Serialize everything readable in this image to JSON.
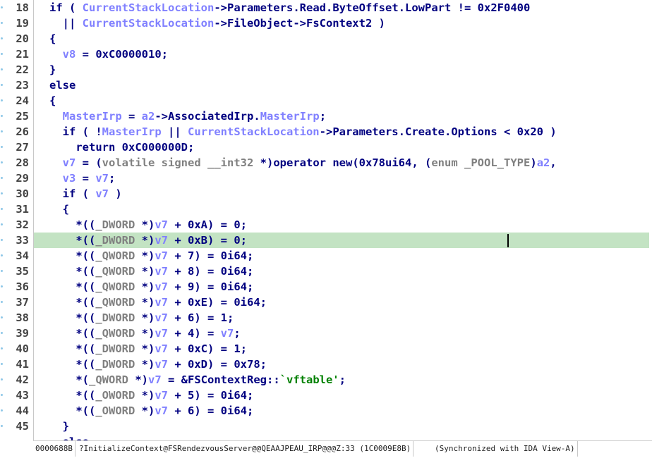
{
  "highlight_line": "33",
  "lines": [
    {
      "num": "18",
      "code": "if ( CurrentStackLocation->Parameters.Read.ByteOffset.LowPart != 0x2F0400"
    },
    {
      "num": "19",
      "code": "  || CurrentStackLocation->FileObject->FsContext2 )"
    },
    {
      "num": "20",
      "code": "{"
    },
    {
      "num": "21",
      "code": "  v8 = 0xC0000010;"
    },
    {
      "num": "22",
      "code": "}"
    },
    {
      "num": "23",
      "code": "else"
    },
    {
      "num": "24",
      "code": "{"
    },
    {
      "num": "25",
      "code": "  MasterIrp = a2->AssociatedIrp.MasterIrp;"
    },
    {
      "num": "26",
      "code": "  if ( !MasterIrp || CurrentStackLocation->Parameters.Create.Options < 0x20 )"
    },
    {
      "num": "27",
      "code": "    return 0xC000000D;"
    },
    {
      "num": "28",
      "code": "  v7 = (volatile signed __int32 *)operator new(0x78ui64, (enum _POOL_TYPE)a2,"
    },
    {
      "num": "29",
      "code": "  v3 = v7;"
    },
    {
      "num": "30",
      "code": "  if ( v7 )"
    },
    {
      "num": "31",
      "code": "  {"
    },
    {
      "num": "32",
      "code": "    *((_DWORD *)v7 + 0xA) = 0;"
    },
    {
      "num": "33",
      "code": "    *((_DWORD *)v7 + 0xB) = 0;"
    },
    {
      "num": "34",
      "code": "    *((_QWORD *)v7 + 7) = 0i64;"
    },
    {
      "num": "35",
      "code": "    *((_QWORD *)v7 + 8) = 0i64;"
    },
    {
      "num": "36",
      "code": "    *((_QWORD *)v7 + 9) = 0i64;"
    },
    {
      "num": "37",
      "code": "    *((_QWORD *)v7 + 0xE) = 0i64;"
    },
    {
      "num": "38",
      "code": "    *((_DWORD *)v7 + 6) = 1;"
    },
    {
      "num": "39",
      "code": "    *((_QWORD *)v7 + 4) = v7;"
    },
    {
      "num": "40",
      "code": "    *((_DWORD *)v7 + 0xC) = 1;"
    },
    {
      "num": "41",
      "code": "    *((_DWORD *)v7 + 0xD) = 0x78;"
    },
    {
      "num": "42",
      "code": "    *(_QWORD *)v7 = &FSContextReg::`vftable';"
    },
    {
      "num": "43",
      "code": "    *((_OWORD *)v7 + 5) = 0i64;"
    },
    {
      "num": "44",
      "code": "    *((_OWORD *)v7 + 6) = 0i64;"
    },
    {
      "num": "45",
      "code": "  }"
    },
    {
      "num": "",
      "code": "  else"
    }
  ],
  "status": {
    "address": "0000688B",
    "function": "?InitializeContext@FSRendezvousServer@@QEAAJPEAU_IRP@@@Z:33 (1C0009E8B)",
    "sync": "(Synchronized with IDA View-A)"
  },
  "colors": {
    "keyword": "#000080",
    "variable": "#8080ff",
    "type": "#808080",
    "string": "#008000",
    "highlight": "#c3e3c3"
  }
}
